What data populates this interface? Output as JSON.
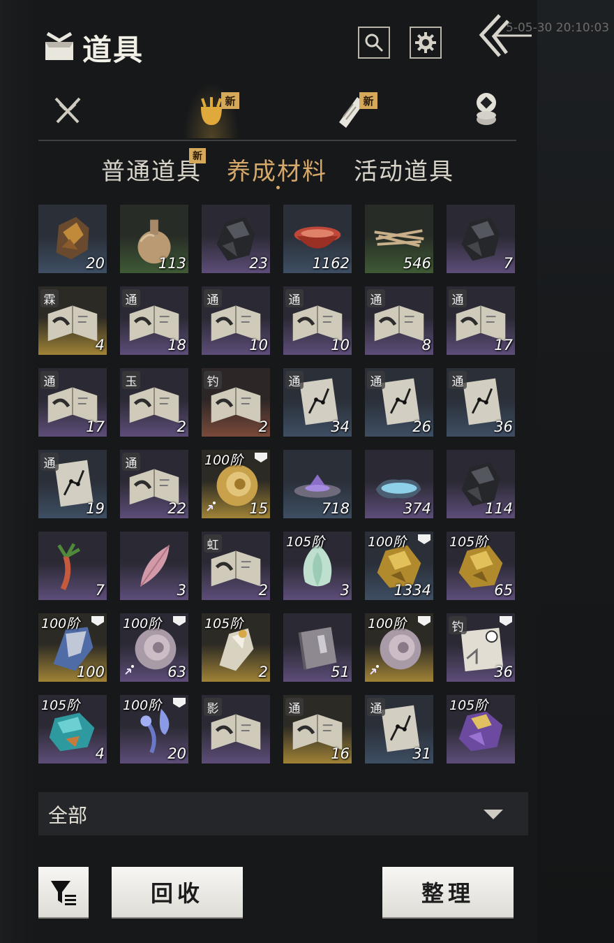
{
  "header": {
    "title": "道具",
    "timestamp": "5-05-30 20:10:03",
    "search_icon": "search-icon",
    "settings_icon": "gear-icon",
    "back_icon": "back-chevrons-icon"
  },
  "category_tabs": [
    {
      "icon": "crossed-swords-icon",
      "new": ""
    },
    {
      "icon": "bag-icon",
      "new": "新",
      "active": true
    },
    {
      "icon": "scroll-icon",
      "new": "新"
    },
    {
      "icon": "coin-stack-icon",
      "new": ""
    }
  ],
  "sub_tabs": [
    {
      "label": "普通道具",
      "new": "新"
    },
    {
      "label": "养成材料",
      "active": true
    },
    {
      "label": "活动道具"
    }
  ],
  "items": [
    {
      "qty": "20",
      "rarity": "blue",
      "art": "ore-brown"
    },
    {
      "qty": "113",
      "rarity": "green",
      "art": "gourd"
    },
    {
      "qty": "23",
      "rarity": "purple",
      "art": "ore-black"
    },
    {
      "qty": "1162",
      "rarity": "blue",
      "art": "red-bowl"
    },
    {
      "qty": "546",
      "rarity": "green",
      "art": "twigs"
    },
    {
      "qty": "7",
      "rarity": "purple",
      "art": "ore-black"
    },
    {
      "qty": "4",
      "rarity": "gold",
      "art": "book",
      "tag": "霖"
    },
    {
      "qty": "18",
      "rarity": "purple",
      "art": "book",
      "tag": "通"
    },
    {
      "qty": "10",
      "rarity": "purple",
      "art": "book",
      "tag": "通"
    },
    {
      "qty": "10",
      "rarity": "purple",
      "art": "book",
      "tag": "通"
    },
    {
      "qty": "8",
      "rarity": "purple",
      "art": "book",
      "tag": "通"
    },
    {
      "qty": "17",
      "rarity": "purple",
      "art": "book",
      "tag": "通"
    },
    {
      "qty": "17",
      "rarity": "purple",
      "art": "book",
      "tag": "通"
    },
    {
      "qty": "2",
      "rarity": "purple",
      "art": "book",
      "tag": "玉"
    },
    {
      "qty": "2",
      "rarity": "red",
      "art": "book",
      "tag": "钓"
    },
    {
      "qty": "34",
      "rarity": "blue",
      "art": "map",
      "tag": "通"
    },
    {
      "qty": "26",
      "rarity": "blue",
      "art": "map",
      "tag": "通"
    },
    {
      "qty": "36",
      "rarity": "blue",
      "art": "map",
      "tag": "通"
    },
    {
      "qty": "19",
      "rarity": "blue",
      "art": "map",
      "tag": "通"
    },
    {
      "qty": "22",
      "rarity": "purple",
      "art": "book",
      "tag": "通"
    },
    {
      "qty": "15",
      "rarity": "gold",
      "art": "shell-gold",
      "tier": "100阶",
      "lock": true,
      "sparkle": true
    },
    {
      "qty": "718",
      "rarity": "blue",
      "art": "purple-dish"
    },
    {
      "qty": "374",
      "rarity": "purple",
      "art": "blue-puddle"
    },
    {
      "qty": "114",
      "rarity": "purple",
      "art": "ore-black"
    },
    {
      "qty": "7",
      "rarity": "purple",
      "art": "root"
    },
    {
      "qty": "3",
      "rarity": "purple",
      "art": "petal"
    },
    {
      "qty": "2",
      "rarity": "purple",
      "art": "book",
      "tag": "虹"
    },
    {
      "qty": "3",
      "rarity": "purple",
      "art": "jade-bud",
      "tier": "105阶"
    },
    {
      "qty": "1334",
      "rarity": "blue",
      "art": "gold-ore",
      "tier": "100阶",
      "lock": true
    },
    {
      "qty": "65",
      "rarity": "purple",
      "art": "gold-ore",
      "tier": "105阶"
    },
    {
      "qty": "100",
      "rarity": "gold",
      "art": "blue-crystal",
      "tier": "100阶",
      "lock": true
    },
    {
      "qty": "63",
      "rarity": "purple",
      "art": "shell-pink",
      "tier": "100阶",
      "lock": true,
      "sparkle": true
    },
    {
      "qty": "2",
      "rarity": "gold",
      "art": "white-crystal",
      "tier": "105阶"
    },
    {
      "qty": "51",
      "rarity": "purple",
      "art": "plain-book"
    },
    {
      "qty": "",
      "rarity": "gold",
      "art": "shell-pink",
      "tier": "100阶",
      "lock": true,
      "sparkle": true
    },
    {
      "qty": "36",
      "rarity": "purple",
      "art": "letter",
      "tag": "钓",
      "lock": true
    },
    {
      "qty": "4",
      "rarity": "purple",
      "art": "teal-ore",
      "tier": "105阶"
    },
    {
      "qty": "20",
      "rarity": "purple",
      "art": "orchid",
      "tier": "100阶",
      "lock": true
    },
    {
      "qty": "",
      "rarity": "purple",
      "art": "book",
      "tag": "影"
    },
    {
      "qty": "16",
      "rarity": "gold",
      "art": "book",
      "tag": "通"
    },
    {
      "qty": "31",
      "rarity": "blue",
      "art": "map",
      "tag": "通"
    },
    {
      "qty": "",
      "rarity": "purple",
      "art": "amethyst",
      "tier": "105阶"
    }
  ],
  "filter": {
    "label": "全部"
  },
  "buttons": {
    "filter_icon": "filter-icon",
    "recycle": "回收",
    "sort": "整理"
  }
}
